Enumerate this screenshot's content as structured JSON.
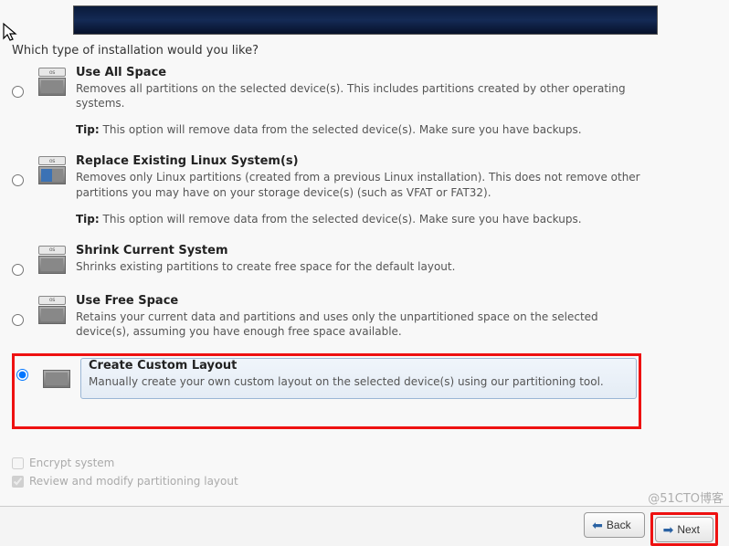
{
  "heading": "Which type of installation would you like?",
  "options": [
    {
      "id": "use-all-space",
      "icon": "disk-full-icon",
      "os_badge": "os",
      "title": "Use All Space",
      "desc": "Removes all partitions on the selected device(s).  This includes partitions created by other operating systems.",
      "tip_label": "Tip:",
      "tip": "This option will remove data from the selected device(s).  Make sure you have backups.",
      "selected": false
    },
    {
      "id": "replace-linux",
      "icon": "disk-split-icon",
      "os_badge": "os",
      "title": "Replace Existing Linux System(s)",
      "desc": "Removes only Linux partitions (created from a previous Linux installation).  This does not remove other partitions you may have on your storage device(s) (such as VFAT or FAT32).",
      "tip_label": "Tip:",
      "tip": "This option will remove data from the selected device(s).  Make sure you have backups.",
      "selected": false
    },
    {
      "id": "shrink-current",
      "icon": "disk-shrink-icon",
      "os_badge": "os",
      "title": "Shrink Current System",
      "desc": "Shrinks existing partitions to create free space for the default layout.",
      "tip_label": "",
      "tip": "",
      "selected": false
    },
    {
      "id": "use-free-space",
      "icon": "disk-free-icon",
      "os_badge": "os",
      "title": "Use Free Space",
      "desc": "Retains your current data and partitions and uses only the unpartitioned space on the selected device(s), assuming you have enough free space available.",
      "tip_label": "",
      "tip": "",
      "selected": false
    },
    {
      "id": "custom-layout",
      "icon": "disk-custom-icon",
      "os_badge": "",
      "title": "Create Custom Layout",
      "desc": "Manually create your own custom layout on the selected device(s) using our partitioning tool.",
      "tip_label": "",
      "tip": "",
      "selected": true
    }
  ],
  "checks": {
    "encrypt": {
      "label": "Encrypt system",
      "checked": false,
      "enabled": false
    },
    "review": {
      "label": "Review and modify partitioning layout",
      "checked": true,
      "enabled": false
    }
  },
  "buttons": {
    "back": "Back",
    "next": "Next"
  },
  "watermark": "@51CTO博客"
}
